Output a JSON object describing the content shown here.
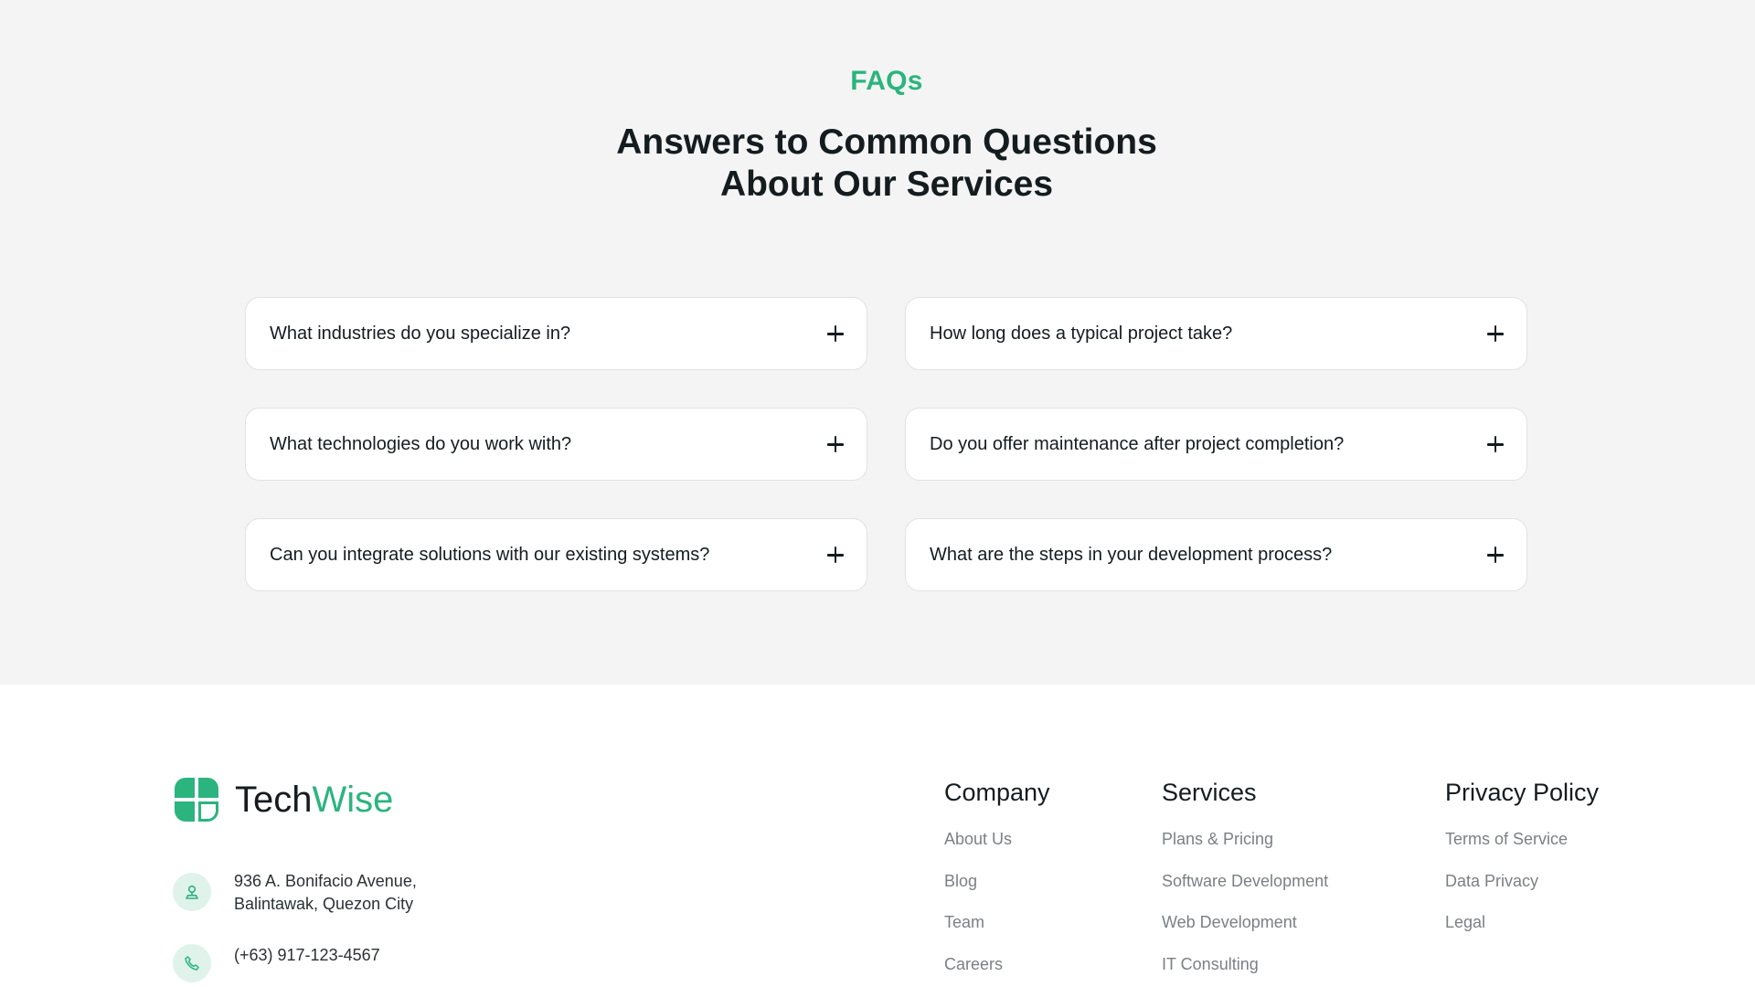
{
  "faq": {
    "eyebrow": "FAQs",
    "title_line1": "Answers to Common Questions",
    "title_line2": "About Our Services",
    "items": [
      "What industries do you specialize in?",
      "How long does a typical project take?",
      "What technologies do you work with?",
      "Do you offer maintenance after project completion?",
      "Can you integrate solutions with our existing systems?",
      "What are the steps in your development process?"
    ]
  },
  "footer": {
    "brand_a": "Tech",
    "brand_b": "Wise",
    "address_line1": "936 A. Bonifacio Avenue,",
    "address_line2": "Balintawak, Quezon City",
    "phone": "(+63) 917-123-4567",
    "columns": [
      {
        "title": "Company",
        "links": [
          "About Us",
          "Blog",
          "Team",
          "Careers"
        ]
      },
      {
        "title": "Services",
        "links": [
          "Plans & Pricing",
          "Software Development",
          "Web Development",
          "IT Consulting"
        ]
      },
      {
        "title": "Privacy Policy",
        "links": [
          "Terms of Service",
          "Data Privacy",
          "Legal"
        ]
      }
    ]
  },
  "colors": {
    "accent": "#2bb47e",
    "section_bg": "#f4f4f4",
    "text": "#141c1f",
    "muted": "#7b8084"
  },
  "icons": [
    "plus-icon",
    "logo-icon",
    "location-icon",
    "phone-icon"
  ]
}
